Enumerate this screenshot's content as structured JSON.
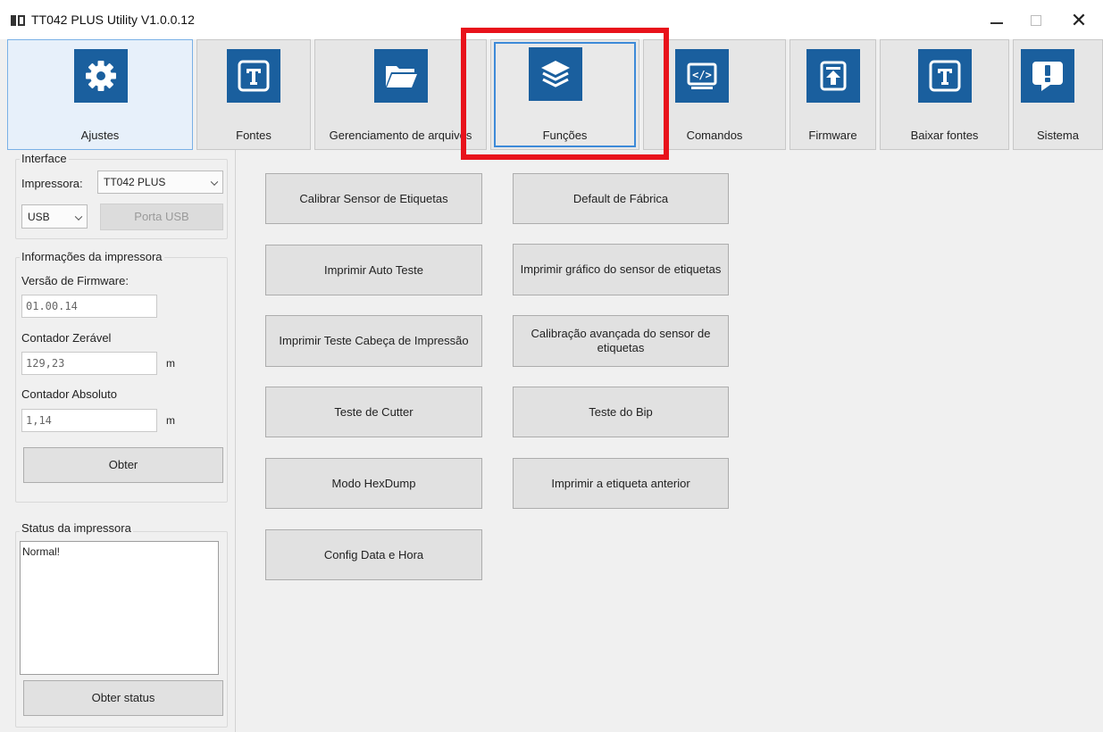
{
  "window": {
    "title": "TT042 PLUS Utility  V1.0.0.12",
    "minimize": "—",
    "maximize": "",
    "close": "✕"
  },
  "colors": {
    "accent": "#1a5f9e",
    "highlight_box": "#e8121b",
    "focus_border": "#3d8ad8"
  },
  "tabs": [
    {
      "label": "Ajustes",
      "icon": "gear-icon"
    },
    {
      "label": "Fontes",
      "icon": "font-t-icon"
    },
    {
      "label": "Gerenciamento de arquivos",
      "icon": "folder-icon"
    },
    {
      "label": "Funções",
      "icon": "layers-icon"
    },
    {
      "label": "Comandos",
      "icon": "code-icon"
    },
    {
      "label": "Firmware",
      "icon": "upload-icon"
    },
    {
      "label": "Baixar fontes",
      "icon": "font-t-icon"
    },
    {
      "label": "Sistema",
      "icon": "alert-icon"
    }
  ],
  "interface": {
    "group_label": "Interface",
    "printer_label": "Impressora:",
    "printer_value": "TT042 PLUS",
    "port_value": "USB",
    "port_button": "Porta USB"
  },
  "printer_info": {
    "group_label": "Informações da impressora",
    "firmware_label": "Versão de Firmware:",
    "firmware_value": "01.00.14",
    "reset_counter_label": "Contador Zerável",
    "reset_counter_value": "129,23",
    "reset_counter_unit": "m",
    "absolute_counter_label": "Contador Absoluto",
    "absolute_counter_value": "1,14",
    "absolute_counter_unit": "m",
    "get_button": "Obter"
  },
  "printer_status": {
    "group_label": "Status da impressora",
    "status_text": "Normal!",
    "get_status_button": "Obter status"
  },
  "functions": {
    "calibrate_sensor": "Calibrar Sensor de Etiquetas",
    "factory_default": "Default de Fábrica",
    "print_self_test": "Imprimir Auto Teste",
    "print_sensor_graph": "Imprimir gráfico do sensor de etiquetas",
    "print_head_test": "Imprimir Teste Cabeça de Impressão",
    "advanced_sensor_calibration": "Calibração avançada do sensor de etiquetas",
    "cutter_test": "Teste de Cutter",
    "beep_test": "Teste do Bip",
    "hexdump_mode": "Modo HexDump",
    "print_previous_label": "Imprimir a etiqueta anterior",
    "date_time_config": "Config Data e Hora"
  }
}
